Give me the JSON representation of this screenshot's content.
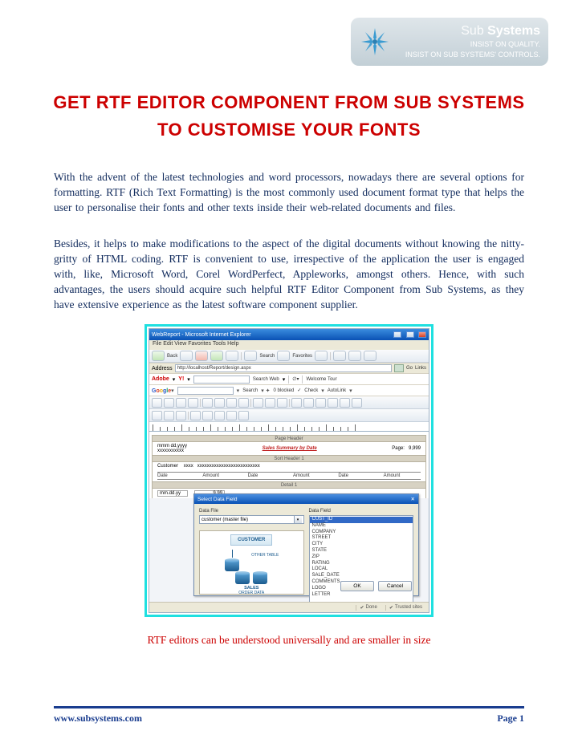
{
  "logo": {
    "brand_sub": "Sub",
    "brand_sys": "Systems",
    "tag_l1": "INSIST ON QUALITY.",
    "tag_l2": "INSIST ON SUB SYSTEMS' CONTROLS."
  },
  "title_l1": "GET RTF EDITOR COMPONENT FROM SUB SYSTEMS",
  "title_l2": "TO CUSTOMISE YOUR FONTS",
  "paragraph1": "With the advent of the latest technologies and word processors, nowadays there are several options for formatting. RTF (Rich Text Formatting) is the most commonly used document format type that helps the user to personalise their fonts and other texts inside their web-related documents and files.",
  "paragraph2": "Besides, it helps to make modifications to the aspect of the digital documents without knowing the nitty-gritty of HTML coding. RTF is convenient to use, irrespective of the application the user is engaged with, like, Microsoft Word, Corel WordPerfect, Appleworks, amongst others. Hence, with such advantages, the users should acquire such helpful RTF Editor Component from Sub Systems, as they have extensive experience as the latest software component supplier.",
  "app": {
    "window_title": "WebReport - Microsoft Internet Explorer",
    "menubar": "File   Edit   View   Favorites   Tools   Help",
    "address_label": "Address",
    "address_value": "http://localhost/Report/design.aspx",
    "go": "Go",
    "links": "Links",
    "ie_back": "Back",
    "ie_search": "Search",
    "ie_fav": "Favorites",
    "adobe_label": "Adobe",
    "yahoo_label": "Y!",
    "search_btn": "Search Web",
    "welcome": "Welcome Tour",
    "google_label": "Google",
    "g_search": "Search",
    "g_blocked": "0 blocked",
    "g_check": "Check",
    "g_autolink": "AutoLink",
    "band_page_header": "Page Header",
    "band_sort_header": "Sort Header 1",
    "band_detail": "Detail 1",
    "sum_date_fmt": "mmm dd,yyyy",
    "sum_x": "xxxxxxxxxxx",
    "sum_title": "Sales Summary by Date",
    "sum_page": "Page:",
    "sum_page_val": "9,999",
    "sort_customer": "Customer",
    "sort_xxxx": "xxxx",
    "sort_xlong": "xxxxxxxxxxxxxxxxxxxxxxxxxx",
    "col_date": "Date",
    "col_amount": "Amount",
    "detail_date": "mm.dd.yy",
    "detail_amt": "9,99",
    "dialog_title": "Select Data Field",
    "dlg_datafile": "Data File",
    "dlg_combo": "customer (master file)",
    "dlg_datafield": "Data Field",
    "diagram_customer": "CUSTOMER",
    "diagram_other": "OTHER TABLE",
    "diagram_sales": "SALES",
    "diagram_order": "ORDER DATA",
    "fields": [
      "CUST_ID",
      "NAME",
      "COMPANY",
      "STREET",
      "CITY",
      "STATE",
      "ZIP",
      "RATING",
      "LOCAL",
      "SALE_DATE",
      "COMMENTS",
      "LOGO",
      "LETTER"
    ],
    "ok": "OK",
    "cancel": "Cancel",
    "status_done": "Done",
    "status_trusted": "Trusted sites"
  },
  "caption": "RTF editors can be understood universally and are smaller in size",
  "footer_url": "www.subsystems.com",
  "footer_page": "Page 1"
}
